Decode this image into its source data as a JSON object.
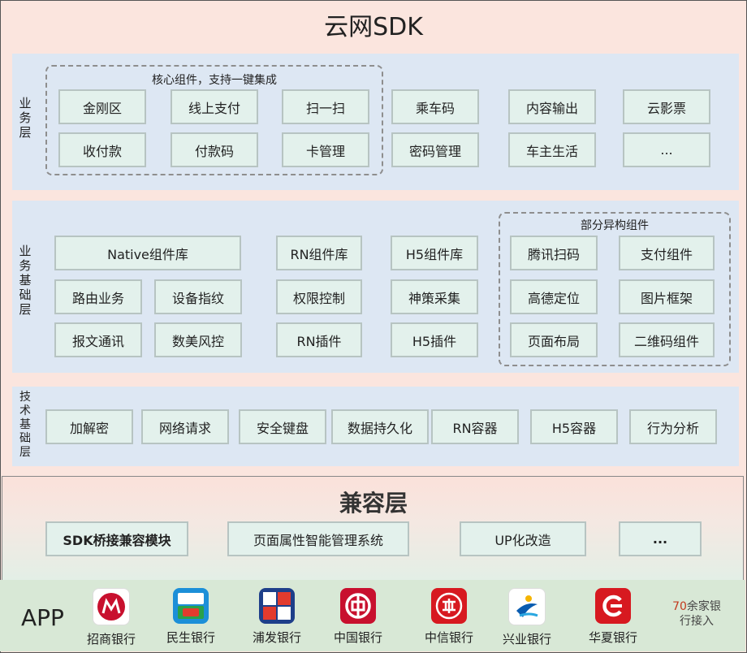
{
  "title": "云网SDK",
  "business_layer": {
    "label": "业务层",
    "core_group_label": "核心组件，支持一键集成",
    "core_items": [
      "金刚区",
      "线上支付",
      "扫一扫",
      "收付款",
      "付款码",
      "卡管理"
    ],
    "other_items": [
      "乘车码",
      "内容输出",
      "云影票",
      "密码管理",
      "车主生活",
      "..."
    ]
  },
  "business_base_layer": {
    "label": "业务基础层",
    "native_lib": "Native组件库",
    "items_left": [
      "路由业务",
      "设备指纹",
      "报文通讯",
      "数美风控"
    ],
    "items_mid": [
      "RN组件库",
      "H5组件库",
      "权限控制",
      "神策采集",
      "RN插件",
      "H5插件"
    ],
    "hetero_group_label": "部分异构组件",
    "hetero_items": [
      "腾讯扫码",
      "支付组件",
      "高德定位",
      "图片框架",
      "页面布局",
      "二维码组件"
    ]
  },
  "tech_base_layer": {
    "label": "技术基础层",
    "items": [
      "加解密",
      "网络请求",
      "安全键盘",
      "数据持久化",
      "RN容器",
      "H5容器",
      "行为分析"
    ]
  },
  "compat_layer": {
    "title": "兼容层",
    "items": [
      "SDK桥接兼容模块",
      "页面属性智能管理系统",
      "UP化改造",
      "..."
    ]
  },
  "app_row": {
    "label": "APP",
    "banks": [
      {
        "name": "招商银行",
        "icon": "cmb-logo-icon",
        "color": "#c8102e"
      },
      {
        "name": "民生银行",
        "icon": "cmbc-logo-icon",
        "color": "#1c8fd8"
      },
      {
        "name": "浦发银行",
        "icon": "spdb-logo-icon",
        "color": "#1e3f8a"
      },
      {
        "name": "中国银行",
        "icon": "boc-logo-icon",
        "color": "#c8102e"
      },
      {
        "name": "中信银行",
        "icon": "citic-logo-icon",
        "color": "#d71920"
      },
      {
        "name": "兴业银行",
        "icon": "cib-logo-icon",
        "color": "#0a5cb0"
      },
      {
        "name": "华夏银行",
        "icon": "hxb-logo-icon",
        "color": "#d71920"
      }
    ],
    "more_banks_num": "70",
    "more_banks_text1": "余家银",
    "more_banks_text2": "行接入"
  }
}
